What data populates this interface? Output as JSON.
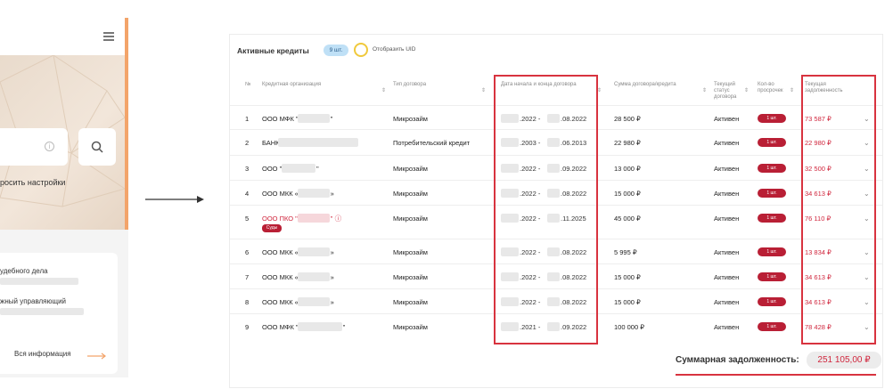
{
  "left": {
    "reset_label": "росить настройки",
    "card_line1": "удебного дела",
    "card_line2": "жный управляющий",
    "all_info_label": "Вся информация"
  },
  "table": {
    "title": "Активные кредиты",
    "count_badge": "9 шт.",
    "toggle_label": "Отобразить UID",
    "headers": {
      "num": "№",
      "org": "Кредитная организация",
      "type": "Тип договора",
      "dates": "Дата начала и конца договора",
      "sum": "Сумма договора/кредита",
      "status": "Текущий статус договора",
      "overdue": "Кол-во просрочек",
      "debt": "Текущая задолженность"
    },
    "rows": [
      {
        "num": "1",
        "org": "ООО МФК \"",
        "org_end": "\"",
        "type": "Микрозайм",
        "start": ".2022 -",
        "end": ".08.2022",
        "sum": "28 500 ₽",
        "status": "Активен",
        "overdue": "1 шт.",
        "debt": "73 587 ₽"
      },
      {
        "num": "2",
        "org": "БАНК",
        "org_end": "",
        "type": "Потребительский кредит",
        "start": ".2003 -",
        "end": ".06.2013",
        "sum": "22 980 ₽",
        "status": "Активен",
        "overdue": "1 шт.",
        "debt": "22 980 ₽"
      },
      {
        "num": "3",
        "org": "ООО \"",
        "org_end": "\"",
        "type": "Микрозайм",
        "start": ".2022 -",
        "end": ".09.2022",
        "sum": "13 000 ₽",
        "status": "Активен",
        "overdue": "1 шт.",
        "debt": "32 500 ₽"
      },
      {
        "num": "4",
        "org": "ООО МКК «",
        "org_end": "»",
        "type": "Микрозайм",
        "start": ".2022 -",
        "end": ".08.2022",
        "sum": "15 000 ₽",
        "status": "Активен",
        "overdue": "1 шт.",
        "debt": "34 613 ₽"
      },
      {
        "num": "5",
        "org": "ООО ПКО \"",
        "org_end": "\"",
        "type": "Микрозайм",
        "start": ".2022 -",
        "end": ".11.2025",
        "sum": "45 000 ₽",
        "status": "Активен",
        "overdue": "1 шт.",
        "debt": "76 110 ₽",
        "court": "Суды"
      },
      {
        "num": "6",
        "org": "ООО МКК «",
        "org_end": "»",
        "type": "Микрозайм",
        "start": ".2022 -",
        "end": ".08.2022",
        "sum": "5 995 ₽",
        "status": "Активен",
        "overdue": "1 шт.",
        "debt": "13 834 ₽"
      },
      {
        "num": "7",
        "org": "ООО МКК «",
        "org_end": "»",
        "type": "Микрозайм",
        "start": ".2022 -",
        "end": ".08.2022",
        "sum": "15 000 ₽",
        "status": "Активен",
        "overdue": "1 шт.",
        "debt": "34 613 ₽"
      },
      {
        "num": "8",
        "org": "ООО МКК «",
        "org_end": "»",
        "type": "Микрозайм",
        "start": ".2022 -",
        "end": ".08.2022",
        "sum": "15 000 ₽",
        "status": "Активен",
        "overdue": "1 шт.",
        "debt": "34 613 ₽"
      },
      {
        "num": "9",
        "org": "ООО МФК \"",
        "org_end": "\"",
        "type": "Микрозайм",
        "start": ".2021 -",
        "end": ".09.2022",
        "sum": "100 000 ₽",
        "status": "Активен",
        "overdue": "1 шт.",
        "debt": "78 428 ₽"
      }
    ],
    "total_label": "Суммарная задолженность:",
    "total_value": "251 105,00 ₽"
  },
  "colors": {
    "accent_red": "#d0263d",
    "badge_blue": "#bfe0f6",
    "toggle_yellow": "#f0c93c",
    "arrow_orange": "#f3a46a"
  }
}
